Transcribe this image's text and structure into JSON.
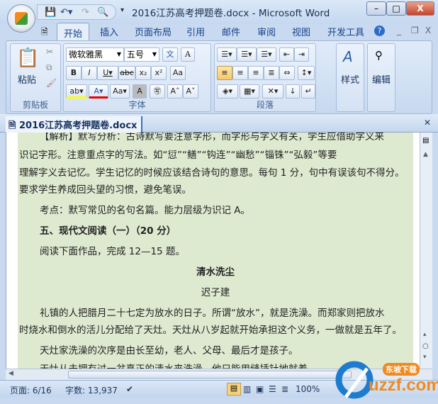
{
  "window": {
    "title": "2016江苏高考押题卷.docx - Microsoft Word"
  },
  "tabs": [
    "开始",
    "插入",
    "页面布局",
    "引用",
    "邮件",
    "审阅",
    "视图",
    "开发工具"
  ],
  "ribbon": {
    "clipboard": {
      "label": "剪贴板",
      "paste": "粘贴"
    },
    "font": {
      "label": "字体",
      "name": "微软雅黑",
      "size": "五号"
    },
    "paragraph": {
      "label": "段落"
    },
    "styles": {
      "label": "样式"
    },
    "editing": {
      "label": "编辑"
    }
  },
  "document_tab": "2016江苏高考押题卷.docx",
  "document": {
    "lines": [
      "【解析】默写分析：古诗默写要注意字形，而字形与字义有关，学生应借助字义来",
      "识记字形。注意重点字的写法。如“愆”“鳝”“钩连”“幽愁”“锱铢”“弘毅”等要",
      "理解字义去记忆。学生记忆的时候应该结合诗句的意思。每句 1 分，句中有误该句不得分。",
      "要求学生养成回头望的习惯，避免笔误。",
      "考点：默写常见的名句名篇。能力层级为识记 A。",
      "五、现代文阅读（一）（20 分）",
      "阅读下面作品，完成 12—15 题。",
      "清水洗尘",
      "迟子建",
      "礼镇的人把腊月二十七定为放水的日子。所谓“放水”，就是洗澡。而郑家则把放水",
      "时烧水和倒水的活儿分配给了天灶。天灶从八岁起就开始承担这个义务，一做就是五年了。",
      "天灶家洗澡的次序是由长至幼，老人、父母、最后才是孩子。",
      "天灶从未拥有过一盆真正的清水来洗澡，他只能用缝插针地就着..."
    ]
  },
  "status": {
    "page": "页面: 6/16",
    "words": "字数: 13,937",
    "zoom": "100%"
  },
  "watermark": {
    "text": "uzzf.com",
    "sub": "东坡下载"
  }
}
